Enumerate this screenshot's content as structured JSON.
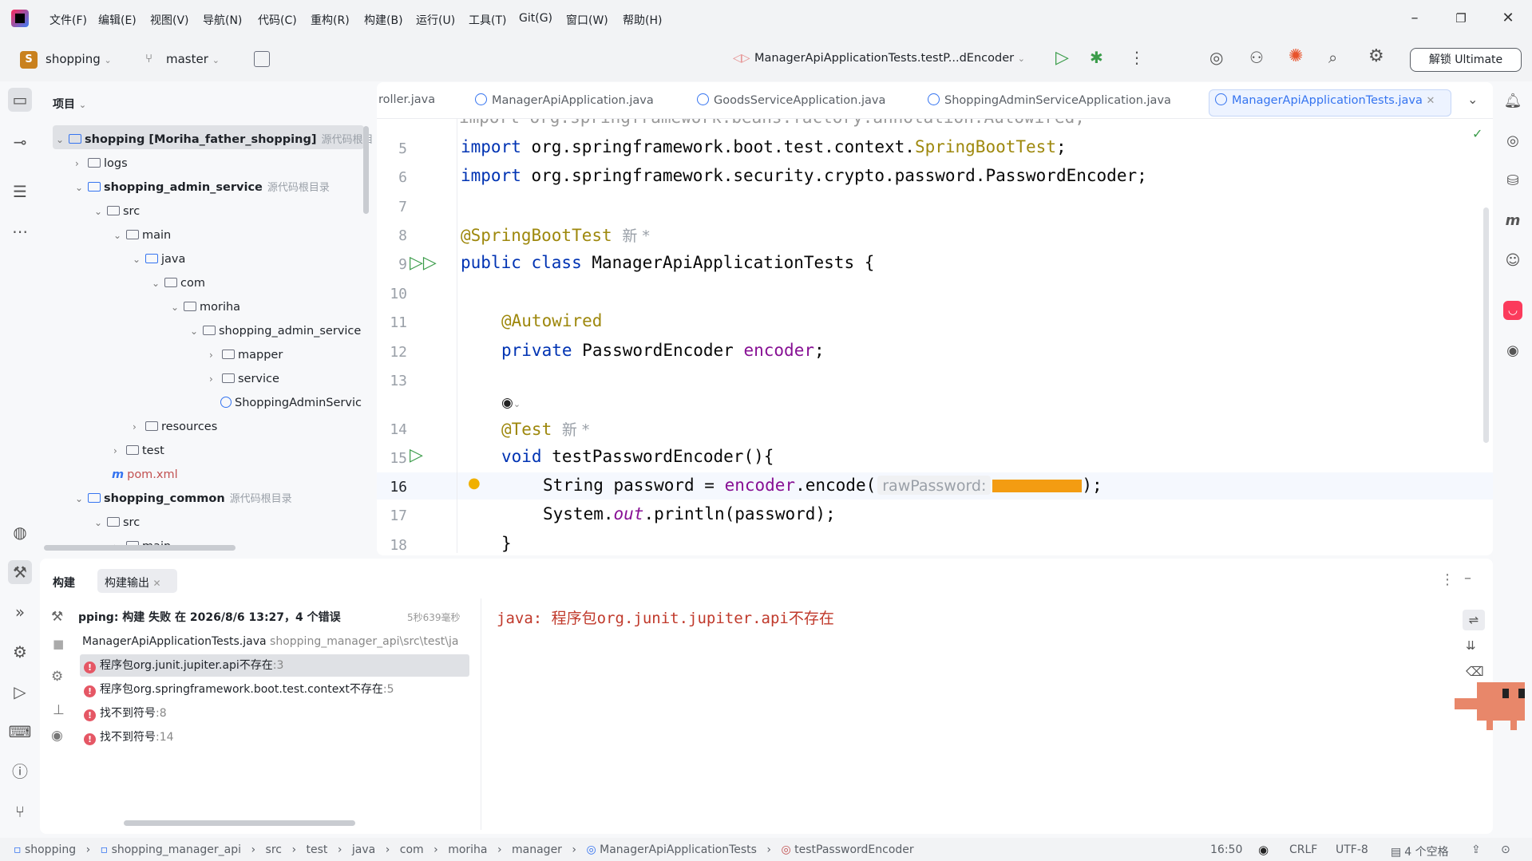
{
  "menu": [
    "文件(F)",
    "编辑(E)",
    "视图(V)",
    "导航(N)",
    "代码(C)",
    "重构(R)",
    "构建(B)",
    "运行(U)",
    "工具(T)",
    "Git(G)",
    "窗口(W)",
    "帮助(H)"
  ],
  "toolbar": {
    "project_badge": "S",
    "project_name": "shopping",
    "branch": "master",
    "run_config": "ManagerApiApplicationTests.testP...dEncoder",
    "ultimate_label": "解锁 Ultimate"
  },
  "project_panel": {
    "title": "项目",
    "items": [
      {
        "label": "shopping [Moriha_father_shopping]",
        "hint": "源代码根目"
      },
      {
        "label": "logs"
      },
      {
        "label": "shopping_admin_service",
        "hint": "源代码根目录"
      },
      {
        "label": "src"
      },
      {
        "label": "main"
      },
      {
        "label": "java"
      },
      {
        "label": "com"
      },
      {
        "label": "moriha"
      },
      {
        "label": "shopping_admin_service"
      },
      {
        "label": "mapper"
      },
      {
        "label": "service"
      },
      {
        "label": "ShoppingAdminServic"
      },
      {
        "label": "resources"
      },
      {
        "label": "test"
      },
      {
        "label": "pom.xml"
      },
      {
        "label": "shopping_common",
        "hint": "源代码根目录"
      },
      {
        "label": "src"
      },
      {
        "label": "main"
      }
    ]
  },
  "tabs": [
    {
      "label": "roller.java"
    },
    {
      "label": "ManagerApiApplication.java"
    },
    {
      "label": "GoodsServiceApplication.java"
    },
    {
      "label": "ShoppingAdminServiceApplication.java"
    },
    {
      "label": "ManagerApiApplicationTests.java"
    }
  ],
  "editor": {
    "line_numbers": [
      "5",
      "6",
      "7",
      "8",
      "9",
      "10",
      "11",
      "12",
      "13",
      "14",
      "15",
      "16",
      "17",
      "18"
    ],
    "line5_kw": "import",
    "line5_pkg": "org.springframework.boot.test.context.",
    "line5_cls": "SpringBootTest",
    "line5_end": ";",
    "line6_kw": "import",
    "line6_rest": "org.springframework.security.crypto.password.PasswordEncoder;",
    "line8_ann": "@SpringBootTest",
    "line8_hint": "新 *",
    "line9_kw": "public class",
    "line9_rest": "ManagerApiApplicationTests {",
    "line11_ann": "@Autowired",
    "line12_kw": "private",
    "line12_type": "PasswordEncoder",
    "line12_field": "encoder",
    "line12_end": ";",
    "line14_ann": "@Test",
    "line14_hint": "新 *",
    "line15_kw": "void",
    "line15_rest": "testPasswordEncoder(){",
    "line16_a": "String password = ",
    "line16_field": "encoder",
    "line16_b": ".encode(",
    "line16_hint": "rawPassword:",
    "line16_end": ");",
    "line17_a": "System.",
    "line17_field": "out",
    "line17_b": ".println(password);",
    "line18": "}"
  },
  "build": {
    "tab_build": "构建",
    "tab_output": "构建输出",
    "root_row": "pping: 构建 失败 在 2026/8/6 13:27，4 个错误",
    "root_time": "5秒639毫秒",
    "file_row": "ManagerApiApplicationTests.java",
    "file_path": "shopping_manager_api\\src\\test\\ja",
    "errors": [
      {
        "msg": "程序包org.junit.jupiter.api不存在",
        "line": ":3"
      },
      {
        "msg": "程序包org.springframework.boot.test.context不存在",
        "line": ":5"
      },
      {
        "msg": "找不到符号",
        "line": ":8"
      },
      {
        "msg": "找不到符号",
        "line": ":14"
      }
    ],
    "output_text": "java: 程序包org.junit.jupiter.api不存在"
  },
  "breadcrumb": [
    "shopping",
    "shopping_manager_api",
    "src",
    "test",
    "java",
    "com",
    "moriha",
    "manager",
    "ManagerApiApplicationTests",
    "testPasswordEncoder"
  ],
  "status": {
    "position": "16:50",
    "line_sep": "CRLF",
    "encoding": "UTF-8",
    "indent": "4 个空格"
  },
  "colors": {
    "accent": "#3574f0",
    "error": "#e55765",
    "keyword": "#0033b3",
    "annotation": "#9e880d",
    "field": "#871094"
  }
}
